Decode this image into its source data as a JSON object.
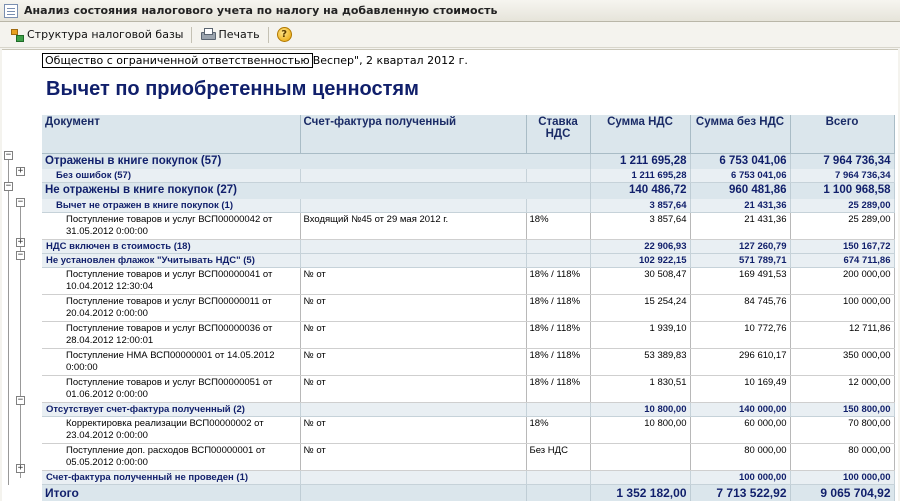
{
  "window": {
    "title": "Анализ состояния налогового учета по налогу на добавленную стоимость"
  },
  "toolbar": {
    "structure_label": "Структура налоговой базы",
    "print_label": "Печать",
    "help_label": "?"
  },
  "report": {
    "org_boxed": "Общество с ограниченной ответственностью",
    "org_rest": "Веспер\", 2 квартал 2012 г.",
    "heading": "Вычет по приобретенным ценностям"
  },
  "table": {
    "headers": [
      "Документ",
      "Счет-фактура полученный",
      "Ставка НДС",
      "Сумма НДС",
      "Сумма без НДС",
      "Всего"
    ],
    "rows": [
      {
        "type": "g1",
        "doc": "Отражены в книге покупок (57)",
        "sf": "",
        "rate": "",
        "nds": "1 211 695,28",
        "wo": "6 753 041,06",
        "total": "7 964 736,34"
      },
      {
        "type": "g2",
        "indent": 2,
        "doc": "Без ошибок (57)",
        "sf": "",
        "rate": "",
        "nds": "1 211 695,28",
        "wo": "6 753 041,06",
        "total": "7 964 736,34"
      },
      {
        "type": "g1",
        "doc": "Не отражены в книге покупок (27)",
        "sf": "",
        "rate": "",
        "nds": "140 486,72",
        "wo": "960 481,86",
        "total": "1 100 968,58"
      },
      {
        "type": "g2",
        "indent": 2,
        "doc": "Вычет не отражен в книге покупок (1)",
        "sf": "",
        "rate": "",
        "nds": "3 857,64",
        "wo": "21 431,36",
        "total": "25 289,00"
      },
      {
        "type": "dr",
        "doc": "Поступление товаров и услуг ВСП00000042 от 31.05.2012 0:00:00",
        "sf": "Входящий №45 от 29 мая 2012 г.",
        "rate": "18%",
        "nds": "3 857,64",
        "wo": "21 431,36",
        "total": "25 289,00"
      },
      {
        "type": "g2",
        "indent": 1,
        "doc": "НДС включен в стоимость (18)",
        "sf": "",
        "rate": "",
        "nds": "22 906,93",
        "wo": "127 260,79",
        "total": "150 167,72"
      },
      {
        "type": "g2",
        "indent": 1,
        "doc": "Не установлен флажок \"Учитывать НДС\" (5)",
        "sf": "",
        "rate": "",
        "nds": "102 922,15",
        "wo": "571 789,71",
        "total": "674 711,86"
      },
      {
        "type": "dr",
        "doc": "Поступление товаров и услуг ВСП00000041 от 10.04.2012 12:30:04",
        "sf": "№  от",
        "rate": "18% / 118%",
        "nds": "30 508,47",
        "wo": "169 491,53",
        "total": "200 000,00"
      },
      {
        "type": "dr",
        "doc": "Поступление товаров и услуг ВСП00000011 от 20.04.2012 0:00:00",
        "sf": "№  от",
        "rate": "18% / 118%",
        "nds": "15 254,24",
        "wo": "84 745,76",
        "total": "100 000,00"
      },
      {
        "type": "dr",
        "doc": "Поступление товаров и услуг ВСП00000036 от 28.04.2012 12:00:01",
        "sf": "№  от",
        "rate": "18% / 118%",
        "nds": "1 939,10",
        "wo": "10 772,76",
        "total": "12 711,86"
      },
      {
        "type": "dr",
        "doc": "Поступление НМА ВСП00000001 от 14.05.2012 0:00:00",
        "sf": "№  от",
        "rate": "18% / 118%",
        "nds": "53 389,83",
        "wo": "296 610,17",
        "total": "350 000,00"
      },
      {
        "type": "dr",
        "doc": "Поступление товаров и услуг ВСП00000051 от 01.06.2012 0:00:00",
        "sf": "№  от",
        "rate": "18% / 118%",
        "nds": "1 830,51",
        "wo": "10 169,49",
        "total": "12 000,00"
      },
      {
        "type": "g2",
        "indent": 1,
        "doc": "Отсутствует счет-фактура полученный (2)",
        "sf": "",
        "rate": "",
        "nds": "10 800,00",
        "wo": "140 000,00",
        "total": "150 800,00"
      },
      {
        "type": "dr",
        "doc": "Корректировка реализации ВСП00000002 от 23.04.2012 0:00:00",
        "sf": "№  от",
        "rate": "18%",
        "nds": "10 800,00",
        "wo": "60 000,00",
        "total": "70 800,00"
      },
      {
        "type": "dr",
        "doc": "Поступление доп. расходов ВСП00000001 от 05.05.2012 0:00:00",
        "sf": "№  от",
        "rate": "Без НДС",
        "nds": "",
        "wo": "80 000,00",
        "total": "80 000,00"
      },
      {
        "type": "g2",
        "indent": 1,
        "doc": "Счет-фактура полученный не проведен (1)",
        "sf": "",
        "rate": "",
        "nds": "",
        "wo": "100 000,00",
        "total": "100 000,00"
      }
    ],
    "total": {
      "label": "Итого",
      "nds": "1 352 182,00",
      "wo": "7 713 522,92",
      "total": "9 065 704,92"
    }
  }
}
